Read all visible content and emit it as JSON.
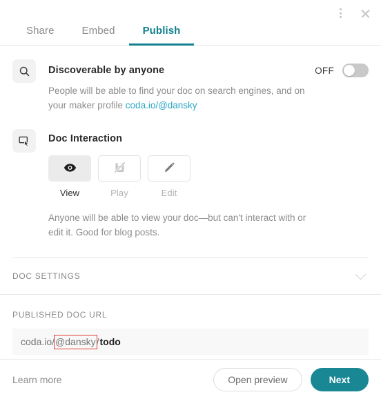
{
  "window": {
    "menu_icon": "kebab-menu-icon",
    "close_icon": "close-icon"
  },
  "tabs": [
    {
      "label": "Share",
      "active": false
    },
    {
      "label": "Embed",
      "active": false
    },
    {
      "label": "Publish",
      "active": true
    }
  ],
  "discoverable": {
    "icon": "search-icon",
    "title": "Discoverable by anyone",
    "toggle_label": "OFF",
    "toggle_state": "off",
    "description_before": "People will be able to find your doc on search engines, and on your maker profile ",
    "description_link": "coda.io/@dansky"
  },
  "doc_interaction": {
    "icon": "screen-cursor-icon",
    "title": "Doc Interaction",
    "modes": [
      {
        "label": "View",
        "icon": "eye-icon",
        "selected": true,
        "disabled": false
      },
      {
        "label": "Play",
        "icon": "interact-off-icon",
        "selected": false,
        "disabled": true
      },
      {
        "label": "Edit",
        "icon": "pencil-icon",
        "selected": false,
        "disabled": false
      }
    ],
    "description": "Anyone will be able to view your doc—but can't interact with or edit it. Good for blog posts."
  },
  "doc_settings": {
    "label": "DOC SETTINGS",
    "chevron_icon": "chevron-down-icon",
    "expanded": false
  },
  "published_url": {
    "label": "PUBLISHED DOC URL",
    "prefix": "coda.io/",
    "handle": "@dansky",
    "separator": "/",
    "slug": "todo",
    "highlight_color": "#e03b2f"
  },
  "footer": {
    "learn_more": "Learn more",
    "open_preview": "Open preview",
    "next": "Next"
  },
  "theme": {
    "accent": "#12818f",
    "primary_button": "#1a8795",
    "link": "#2ba7c4"
  }
}
